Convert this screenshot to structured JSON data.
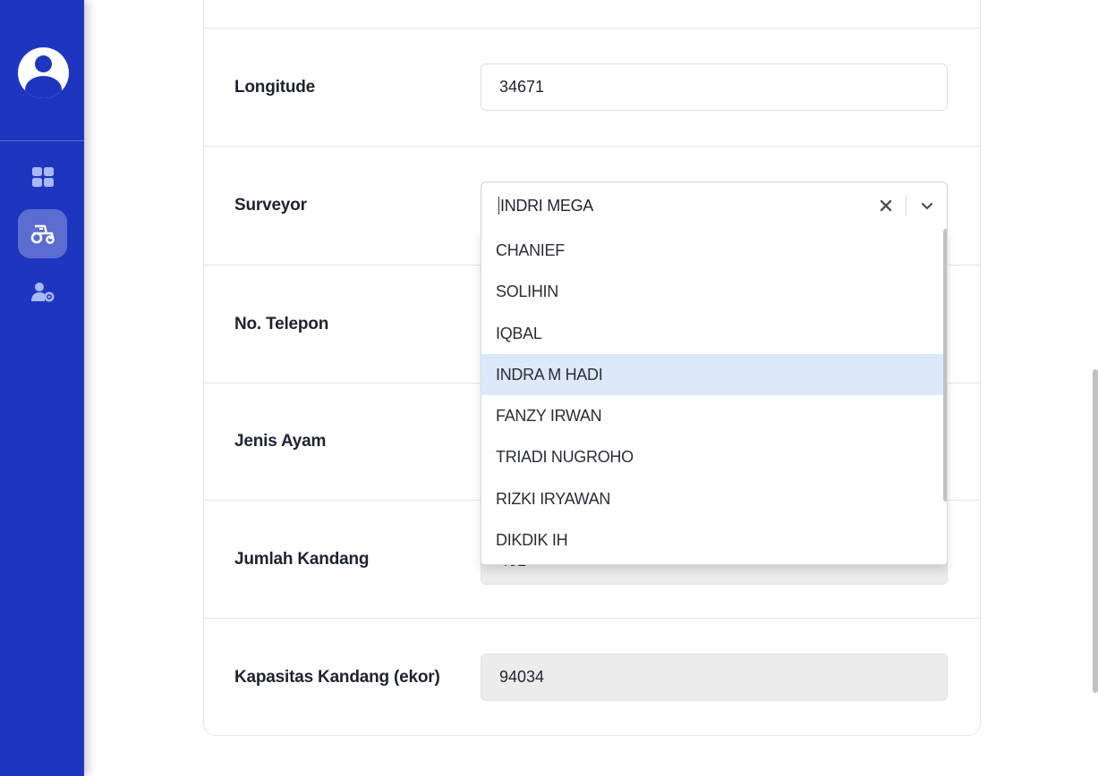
{
  "sidebar": {
    "nav": [
      {
        "icon": "dashboard-grid-icon",
        "active": false
      },
      {
        "icon": "tractor-icon",
        "active": true
      },
      {
        "icon": "user-settings-icon",
        "active": false
      }
    ]
  },
  "form": {
    "longitude": {
      "label": "Longitude",
      "value": "34671"
    },
    "surveyor": {
      "label": "Surveyor",
      "value": "INDRI MEGA"
    },
    "phone": {
      "label": "No. Telepon"
    },
    "chicken_type": {
      "label": "Jenis Ayam"
    },
    "coop_count": {
      "label": "Jumlah Kandang",
      "value": "401"
    },
    "coop_capacity": {
      "label": "Kapasitas Kandang (ekor)",
      "value": "94034"
    }
  },
  "surveyor_dropdown": {
    "options": [
      "CHANIEF",
      "SOLIHIN",
      "IQBAL",
      "INDRA M HADI",
      "FANZY IRWAN",
      "TRIADI NUGROHO",
      "RIZKI IRYAWAN",
      "DIKDIK IH"
    ],
    "highlighted": "INDRA M HADI"
  },
  "colors": {
    "sidebar": "#1e35c0",
    "highlight": "#dde9fb"
  }
}
